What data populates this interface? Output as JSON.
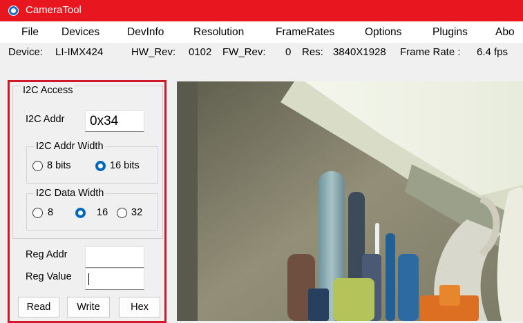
{
  "window": {
    "title": "CameraTool"
  },
  "menu": [
    "File",
    "Devices",
    "DevInfo",
    "Resolution",
    "FrameRates",
    "Options",
    "Plugins",
    "Abo"
  ],
  "info": {
    "device_label": "Device:",
    "device_value": "LI-IMX424",
    "hw_label": "HW_Rev:",
    "hw_value": "0102",
    "fw_label": "FW_Rev:",
    "fw_value": "0",
    "res_label": "Res:",
    "res_value": "3840X1928",
    "fps_label": "Frame Rate :",
    "fps_value": "6.4 fps"
  },
  "i2c": {
    "group_title": "I2C Access",
    "addr_label": "I2C Addr",
    "addr_value": "0x34",
    "addr_width": {
      "title": "I2C Addr Width",
      "options": [
        "8 bits",
        "16 bits"
      ],
      "selected": "16 bits"
    },
    "data_width": {
      "title": "I2C Data Width",
      "options": [
        "8",
        "16",
        "32"
      ],
      "selected": "16"
    },
    "reg_addr_label": "Reg Addr",
    "reg_addr_value": "",
    "reg_value_label": "Reg Value",
    "reg_value_value": ""
  },
  "buttons": {
    "read": "Read",
    "write": "Write",
    "hex": "Hex"
  },
  "colors": {
    "titlebar": "#e8171f",
    "highlight_border": "#d1182b",
    "radio_selected": "#0067c0"
  },
  "icons": [
    "app-logo-icon",
    "camera-preview-image"
  ]
}
